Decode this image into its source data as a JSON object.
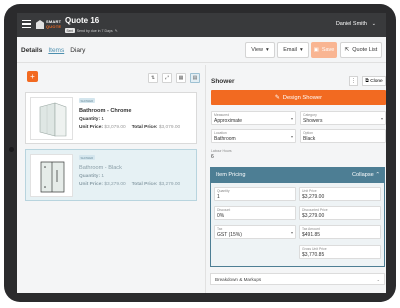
{
  "topbar": {
    "logo_line1": "SMART",
    "logo_line2": "QUOTE",
    "title": "Quote 16",
    "status_badge": "Sent",
    "subtitle": "Send by due in 7 Days",
    "user_name": "Daniel Smith",
    "user_caret": "⌄"
  },
  "tabs": [
    {
      "label": "Details"
    },
    {
      "label": "Items"
    },
    {
      "label": "Diary"
    }
  ],
  "toolbar": {
    "view_label": "View",
    "email_label": "Email",
    "save_label": "Save",
    "quote_list_label": "Quote List"
  },
  "items": [
    {
      "tag": "SHOWER",
      "name": "Bathroom - Chrome",
      "quantity_label": "Quantity:",
      "quantity": "1",
      "unit_price_label": "Unit Price:",
      "unit_price": "$3,079.00",
      "total_price_label": "Total Price:",
      "total_price": "$3,079.00"
    },
    {
      "tag": "SHOWER",
      "name": "Bathroom - Black",
      "quantity_label": "Quantity:",
      "quantity": "1",
      "unit_price_label": "Unit Price:",
      "unit_price": "$3,279.00",
      "total_price_label": "Total Price:",
      "total_price": "$3,279.00"
    }
  ],
  "detail": {
    "title": "Shower",
    "clone_label": "Clone",
    "design_label": "Design Shower",
    "measured": {
      "label": "Measured",
      "value": "Approximate"
    },
    "category": {
      "label": "Category",
      "value": "Showers"
    },
    "location": {
      "label": "Location",
      "value": "Bathroom"
    },
    "option": {
      "label": "Option",
      "value": "Black"
    },
    "labour_hours": {
      "label": "Labour Hours",
      "value": "6"
    }
  },
  "pricing": {
    "title": "Item Pricing",
    "collapse_label": "Collapse",
    "quantity": {
      "label": "Quantity",
      "value": "1"
    },
    "unit_price": {
      "label": "Unit Price",
      "value": "$3,279.00"
    },
    "discount": {
      "label": "Discount",
      "value": "0%"
    },
    "discounted_price": {
      "label": "Discounted Price",
      "value": "$3,279.00"
    },
    "tax": {
      "label": "Tax",
      "value": "GST (15%)"
    },
    "tax_amount": {
      "label": "Tax Amount",
      "value": "$491.85"
    },
    "gross_unit_price": {
      "label": "Gross Unit Price",
      "value": "$3,770.85"
    }
  },
  "breakdown": {
    "label": "Breakdown & Markups"
  },
  "colors": {
    "accent": "#f26a21",
    "header": "#393a3c",
    "pricing_header": "#4d7e94"
  }
}
